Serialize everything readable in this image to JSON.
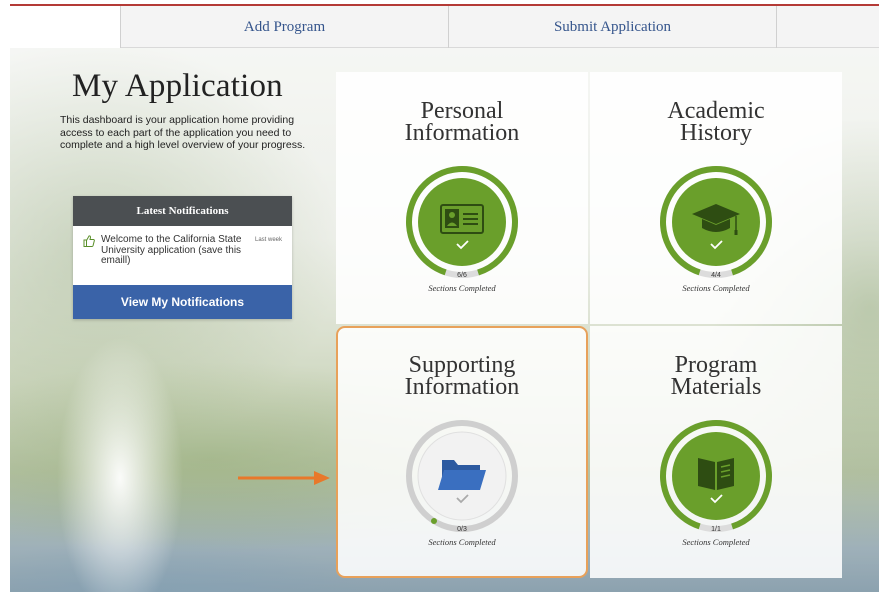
{
  "nav": {
    "tabs": [
      {
        "label": "Add Program"
      },
      {
        "label": "Submit Application"
      }
    ]
  },
  "page": {
    "title": "My Application",
    "intro": "This dashboard is your application home providing access to each part of the application you need to complete and a high level overview of your progress."
  },
  "notifications": {
    "header": "Latest Notifications",
    "items": [
      {
        "text": "Welcome to the California State University application (save this emaill)",
        "date": "Last week",
        "icon": "thumbs-up-icon"
      }
    ],
    "button_label": "View My Notifications"
  },
  "tiles": [
    {
      "line1": "Personal",
      "line2": "Information",
      "count": "6/6",
      "status": "Sections Completed",
      "complete_fraction": 1.0,
      "icon": "id-card-icon",
      "color": "#6a9f2b"
    },
    {
      "line1": "Academic",
      "line2": "History",
      "count": "4/4",
      "status": "Sections Completed",
      "complete_fraction": 1.0,
      "icon": "graduation-cap-icon",
      "color": "#6a9f2b"
    },
    {
      "line1": "Supporting",
      "line2": "Information",
      "count": "0/3",
      "status": "Sections Completed",
      "complete_fraction": 0.0,
      "icon": "folder-icon",
      "color": "#3a63a8",
      "highlighted": true
    },
    {
      "line1": "Program",
      "line2": "Materials",
      "count": "1/1",
      "status": "Sections Completed",
      "complete_fraction": 1.0,
      "icon": "book-icon",
      "color": "#6a9f2b"
    }
  ],
  "colors": {
    "nav_text": "#35558c",
    "green": "#6a9f2b",
    "blue": "#3a63a8",
    "highlight": "#e8a15a",
    "accent_red": "#b43a36"
  }
}
